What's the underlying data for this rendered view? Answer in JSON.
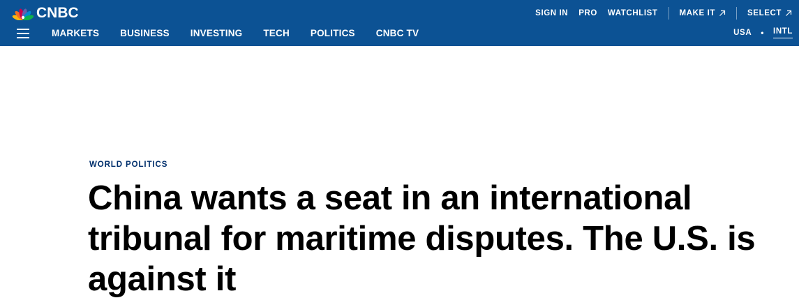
{
  "header": {
    "logo_text": "CNBC",
    "top_links": {
      "sign_in": "SIGN IN",
      "pro": "PRO",
      "watchlist": "WATCHLIST",
      "make_it": "MAKE IT",
      "select": "SELECT"
    },
    "nav": [
      "MARKETS",
      "BUSINESS",
      "INVESTING",
      "TECH",
      "POLITICS",
      "CNBC TV"
    ],
    "region": {
      "usa": "USA",
      "separator": "•",
      "intl": "INTL",
      "active": "INTL"
    },
    "icons": {
      "menu": "hamburger-menu-icon",
      "external": "arrow-up-right-icon",
      "logo": "peacock-logo-icon"
    }
  },
  "article": {
    "kicker": "WORLD POLITICS",
    "headline": "China wants a seat in an international tribunal for maritime disputes. The U.S. is against it"
  },
  "colors": {
    "header_bg": "#0c5294",
    "kicker": "#002f6c",
    "headline": "#000000",
    "peacock": [
      "#fcb711",
      "#f37021",
      "#cc004c",
      "#6460aa",
      "#0089d0",
      "#0db14b"
    ]
  }
}
